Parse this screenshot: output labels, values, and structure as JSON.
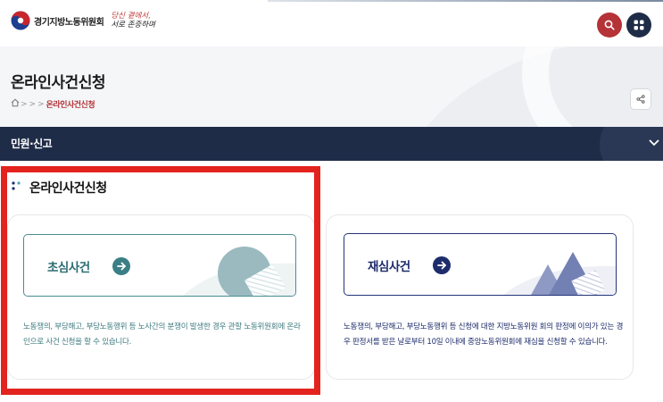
{
  "header": {
    "org_name": "경기지방노동위원회",
    "slogan_line1": "당신 곁에서,",
    "slogan_line2": "서로 존중하며",
    "search_icon": "search-icon",
    "menu_icon": "grid-menu-icon"
  },
  "title_area": {
    "page_title": "온라인사건신청",
    "breadcrumb": {
      "home_icon": "home-icon",
      "separators": [
        ">",
        ">",
        ">"
      ],
      "current": "온라인사건신청"
    },
    "share_icon": "share-icon"
  },
  "category_bar": {
    "label": "민원·신고",
    "chevron_icon": "chevron-down-icon"
  },
  "section": {
    "title": "온라인사건신청"
  },
  "cards": [
    {
      "label": "초심사건",
      "description": "노동쟁의, 부당해고, 부당노동행위 등 노사간의 분쟁이 발생한 경우 관할 노동위원회에 온라인으로 사건 신청을 할 수 있습니다."
    },
    {
      "label": "재심사건",
      "description": "노동쟁의, 부당해고, 부당노동행위 등 신청에 대한 지방노동위원 회의 판정에 이의가 있는 경우 판정서를 받은 날로부터 10일 이내에 중앙노동위원회에 재심을 신청할 수 있습니다."
    }
  ],
  "colors": {
    "navy": "#1f2c48",
    "brand_red": "#b53236",
    "teal": "#3b7f86",
    "highlight_red": "#e3231d"
  }
}
